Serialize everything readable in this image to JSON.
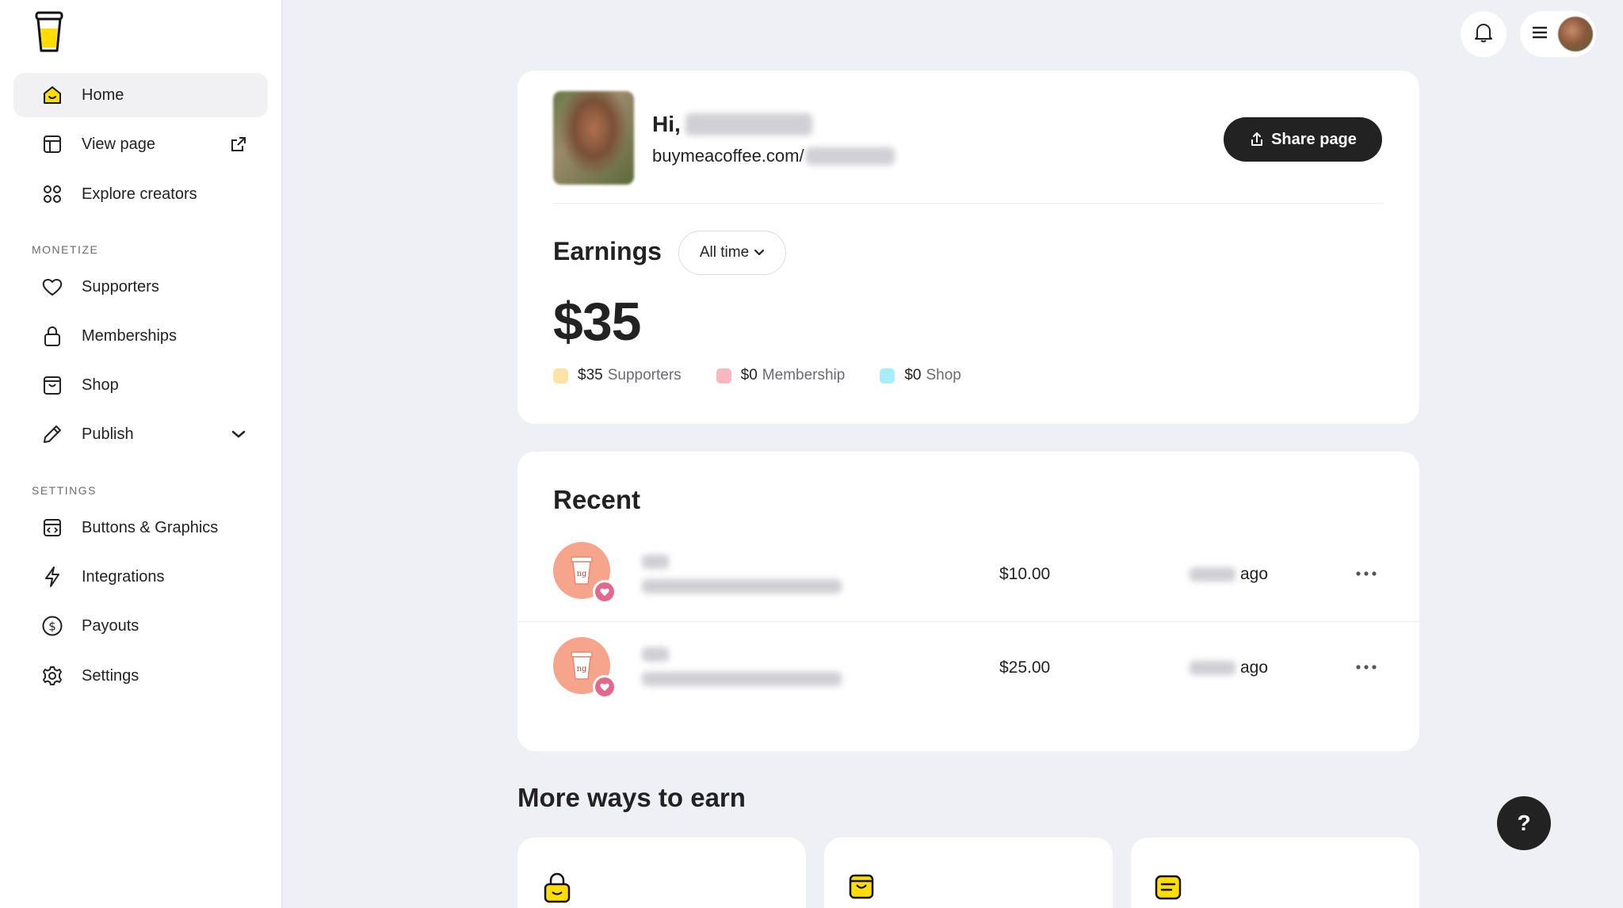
{
  "sidebar": {
    "logo_icon": "coffee-cup-logo",
    "items": [
      {
        "label": "Home",
        "icon": "home-icon",
        "active": true
      },
      {
        "label": "View page",
        "icon": "layout-icon",
        "trail_icon": "external-link-icon"
      },
      {
        "label": "Explore creators",
        "icon": "grid-circles-icon"
      }
    ],
    "monetize_label": "MONETIZE",
    "monetize_items": [
      {
        "label": "Supporters",
        "icon": "heart-icon"
      },
      {
        "label": "Memberships",
        "icon": "lock-icon"
      },
      {
        "label": "Shop",
        "icon": "bag-icon"
      },
      {
        "label": "Publish",
        "icon": "pencil-icon",
        "trail_icon": "chevron-down-icon"
      }
    ],
    "settings_label": "SETTINGS",
    "settings_items": [
      {
        "label": "Buttons & Graphics",
        "icon": "code-window-icon"
      },
      {
        "label": "Integrations",
        "icon": "bolt-icon"
      },
      {
        "label": "Payouts",
        "icon": "dollar-circle-icon"
      },
      {
        "label": "Settings",
        "icon": "gear-icon"
      }
    ]
  },
  "profile": {
    "greeting": "Hi,",
    "url_prefix": "buymeacoffee.com/",
    "share_label": "Share page"
  },
  "earnings": {
    "title": "Earnings",
    "range": "All time",
    "total": "$35",
    "breakdown": [
      {
        "amount": "$35",
        "label": "Supporters",
        "color": "#fde3a7"
      },
      {
        "amount": "$0",
        "label": "Membership",
        "color": "#f9b8bf"
      },
      {
        "amount": "$0",
        "label": "Shop",
        "color": "#a8eef8"
      }
    ]
  },
  "recent": {
    "title": "Recent",
    "rows": [
      {
        "amount": "$10.00",
        "ago": "ago"
      },
      {
        "amount": "$25.00",
        "ago": "ago"
      }
    ]
  },
  "more_ways": {
    "title": "More ways to earn",
    "cards": [
      {
        "icon": "lock-icon"
      },
      {
        "icon": "bag-icon"
      },
      {
        "icon": "post-icon"
      }
    ]
  },
  "help": {
    "label": "?"
  },
  "colors": {
    "accent": "#ffdd00",
    "dark": "#222222",
    "heart": "#e2698e",
    "avatar": "#f7a48d"
  }
}
